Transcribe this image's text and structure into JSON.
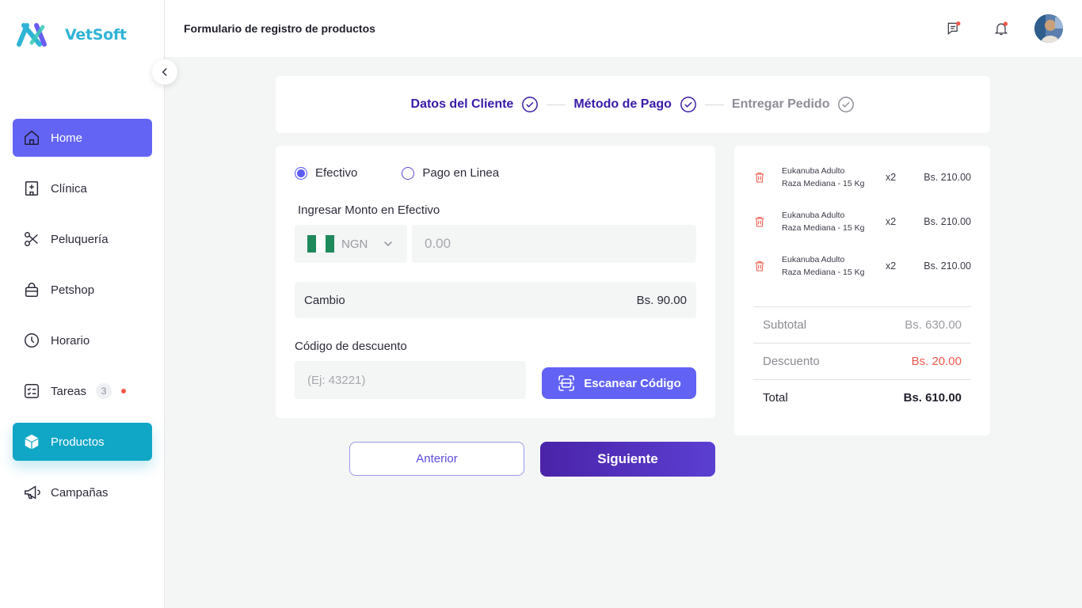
{
  "app": {
    "name": "VetSoft",
    "page_title": "Formulario de registro de productos"
  },
  "sidebar": {
    "items": [
      {
        "label": "Home",
        "icon": "home-icon"
      },
      {
        "label": "Clínica",
        "icon": "clinic-icon"
      },
      {
        "label": "Peluquería",
        "icon": "scissors-icon"
      },
      {
        "label": "Petshop",
        "icon": "bag-icon"
      },
      {
        "label": "Horario",
        "icon": "clock-icon"
      },
      {
        "label": "Tareas",
        "icon": "tasks-icon",
        "badge": "3"
      },
      {
        "label": "Productos",
        "icon": "box-icon"
      },
      {
        "label": "Campañas",
        "icon": "megaphone-icon"
      }
    ]
  },
  "stepper": {
    "steps": [
      {
        "label": "Datos del Cliente",
        "status": "done"
      },
      {
        "label": "Método de Pago",
        "status": "done"
      },
      {
        "label": "Entregar Pedido",
        "status": "pending"
      }
    ]
  },
  "payment": {
    "option_cash": "Efectivo",
    "option_online": "Pago en Linea",
    "selected": "Efectivo",
    "amount_label": "Ingresar Monto en Efectivo",
    "currency": "NGN",
    "amount_placeholder": "0.00",
    "change_label": "Cambio",
    "change_value": "Bs. 90.00",
    "discount_label": "Código de descuento",
    "discount_placeholder": "(Ej: 43221)",
    "scan_label": "Escanear Código"
  },
  "nav_buttons": {
    "prev": "Anterior",
    "next": "Siguiente"
  },
  "summary": {
    "items": [
      {
        "name_line1": "Eukanuba Adulto",
        "name_line2": "Raza Mediana - 15 Kg",
        "qty": "x2",
        "price": "Bs. 210.00"
      },
      {
        "name_line1": "Eukanuba Adulto",
        "name_line2": "Raza Mediana - 15 Kg",
        "qty": "x2",
        "price": "Bs. 210.00"
      },
      {
        "name_line1": "Eukanuba Adulto",
        "name_line2": "Raza Mediana - 15 Kg",
        "qty": "x2",
        "price": "Bs. 210.00"
      }
    ],
    "subtotal_label": "Subtotal",
    "subtotal_value": "Bs. 630.00",
    "discount_label": "Descuento",
    "discount_value": "Bs. 20.00",
    "total_label": "Total",
    "total_value": "Bs. 610.00"
  },
  "colors": {
    "primary": "#6464f4",
    "accent_cyan": "#10a6c6",
    "dark_purple": "#3a1aa8",
    "danger": "#f0584a"
  }
}
